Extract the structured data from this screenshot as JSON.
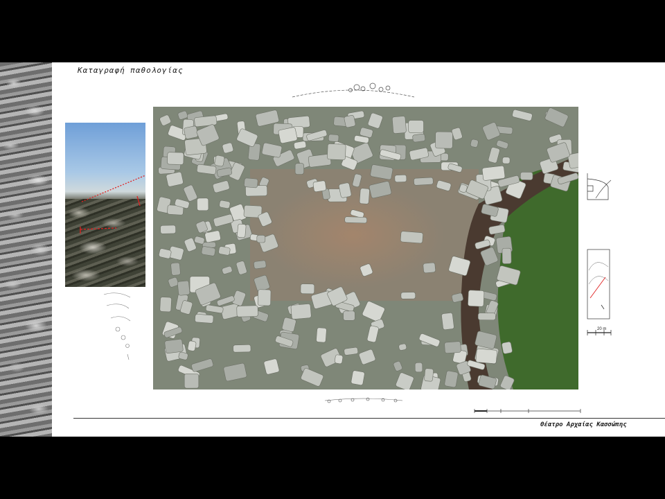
{
  "slide": {
    "title": "Καταγραφή παθολογίας",
    "footer": "Θέατρο Αρχαίας Κασσώπης"
  },
  "drawing": {
    "scale_label": "20 m"
  },
  "colors": {
    "background": "#000000",
    "slide": "#ffffff",
    "annotation_red": "#e02020",
    "grass": "#3f6a2c",
    "stone": "#b9bcb6"
  }
}
